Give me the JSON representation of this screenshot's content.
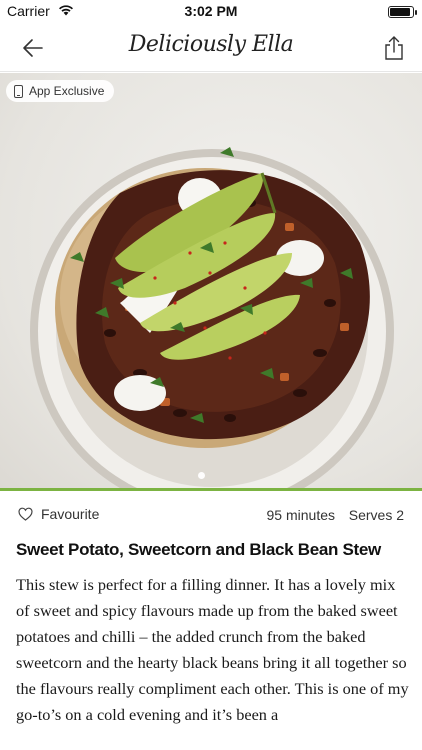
{
  "status": {
    "carrier": "Carrier",
    "time": "3:02 PM",
    "battery_level": 0.9
  },
  "nav": {
    "logo": "Deliciously Ella",
    "back_icon": "arrow-left-icon",
    "share_icon": "share-icon"
  },
  "hero": {
    "badge_label": "App Exclusive",
    "badge_icon": "phone-icon"
  },
  "meta": {
    "favourite_label": "Favourite",
    "favourite_icon": "heart-outline-icon",
    "minutes": "95 minutes",
    "serves": "Serves 2"
  },
  "recipe": {
    "title": "Sweet Potato, Sweetcorn and Black Bean Stew",
    "description": "This stew is perfect for a filling dinner. It has a lovely mix of sweet and spicy flavours made up from the baked sweet potatoes and chilli – the added crunch from the baked sweetcorn and the hearty black beans bring it all together so the flavours really compliment each other. This is one of my go-to’s on a cold evening and it’s been a"
  },
  "colors": {
    "accent_green": "#7cb342"
  }
}
